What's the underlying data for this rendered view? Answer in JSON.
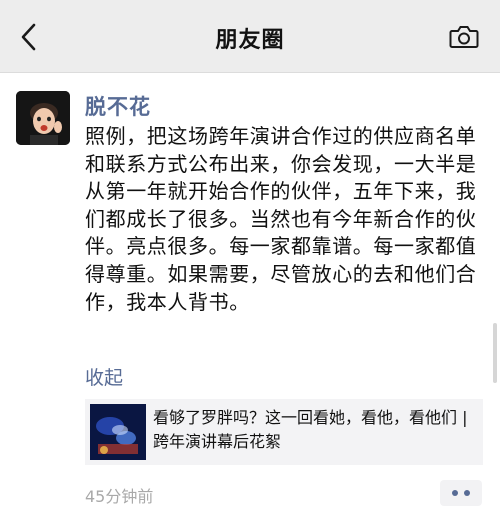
{
  "nav": {
    "title": "朋友圈",
    "back_icon": "back-chevron-icon",
    "camera_icon": "camera-icon"
  },
  "post": {
    "author": "脱不花",
    "text": "照例，把这场跨年演讲合作过的供应商名单和联系方式公布出来，你会发现，一大半是从第一年就开始合作的伙伴，五年下来，我们都成长了很多。当然也有今年新合作的伙伴。亮点很多。每一家都靠谱。每一家都值得尊重。如果需要，尽管放心的去和他们合作，我本人背书。",
    "collapse_label": "收起",
    "shared_link": {
      "title": "看够了罗胖吗？这一回看她，看他，看他们 | 跨年演讲幕后花絮"
    },
    "timestamp": "45分钟前",
    "more_icon": "more-dots-icon"
  },
  "colors": {
    "link": "#576b95",
    "nav_bg": "#ededed",
    "card_bg": "#f3f3f5",
    "timestamp": "#a9a9a9"
  }
}
